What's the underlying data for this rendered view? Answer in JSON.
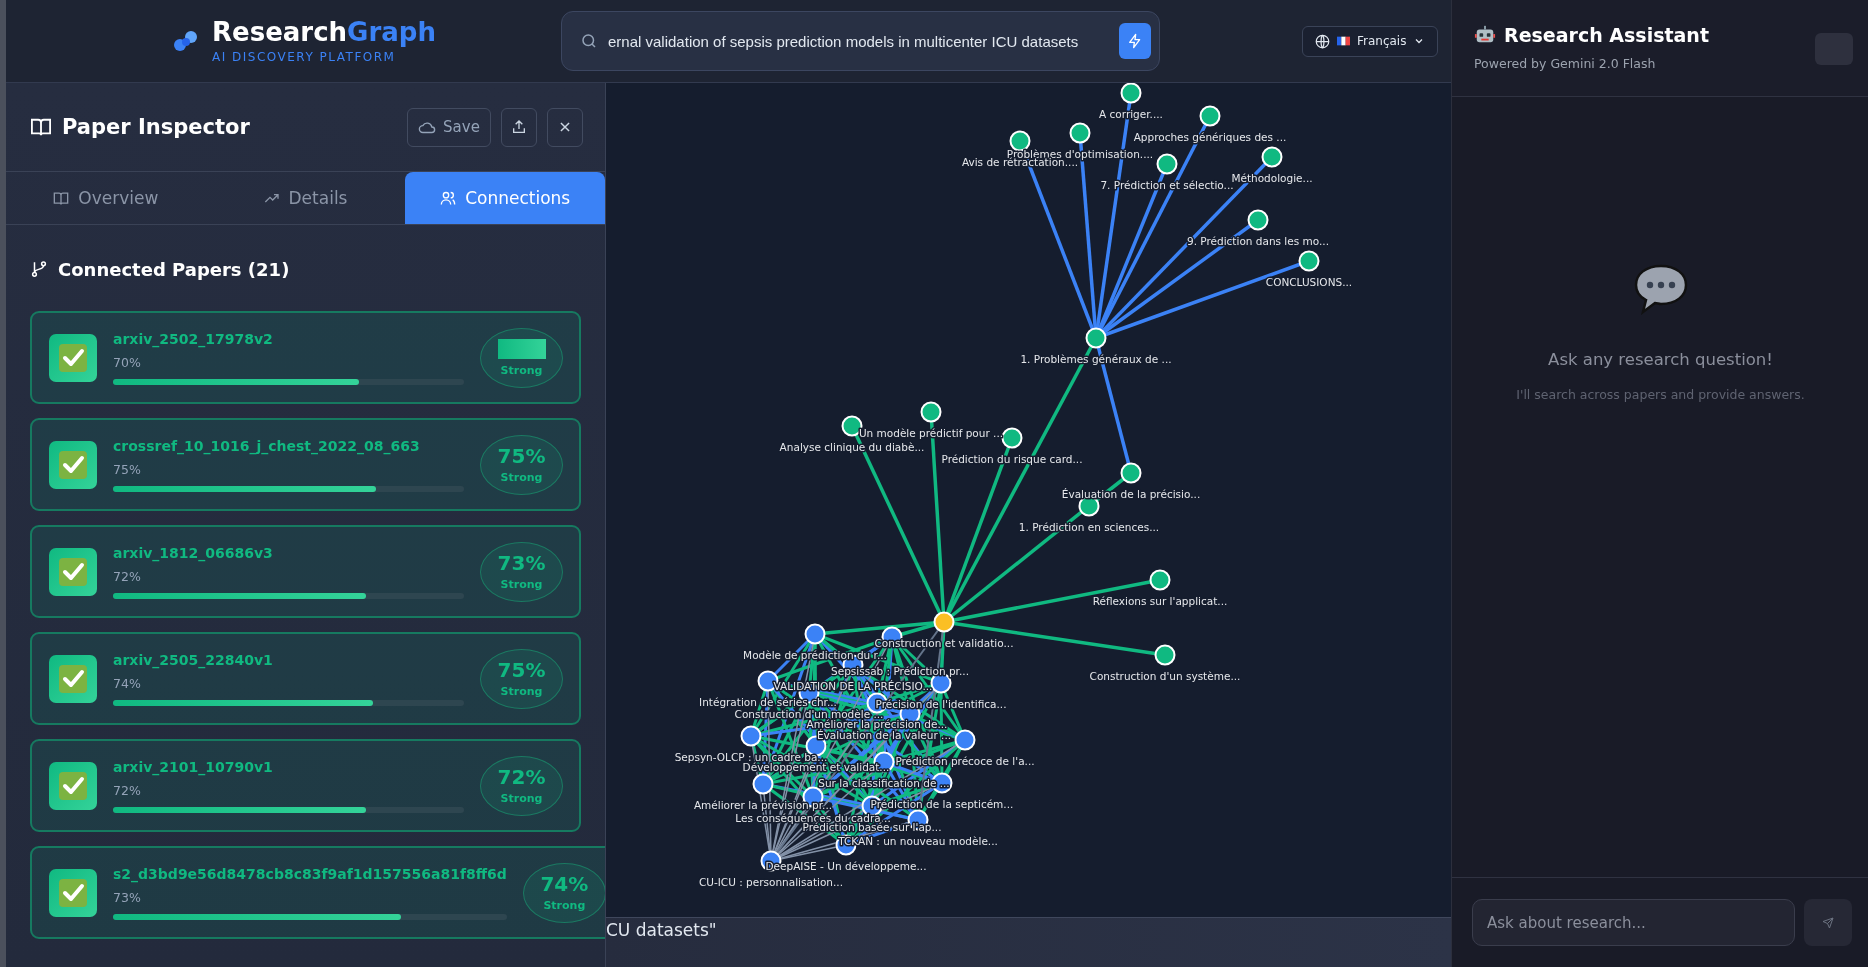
{
  "header": {
    "logo": {
      "text": "Research",
      "accent": "Graph",
      "tagline": "AI DISCOVERY PLATFORM"
    },
    "search": {
      "value": "ernal validation of sepsis prediction models in multicenter ICU datasets"
    },
    "language": {
      "label": "Français"
    }
  },
  "inspector": {
    "title": "Paper Inspector",
    "save": "Save",
    "tabs": [
      {
        "label": "Overview",
        "selected": false
      },
      {
        "label": "Details",
        "selected": false
      },
      {
        "label": "Connections",
        "selected": true
      }
    ],
    "section_title": "Connected Papers (21)",
    "papers": [
      {
        "name": "arxiv_2502_17978v2",
        "similarity": "70%",
        "level": 0.7,
        "badge": "Strong"
      },
      {
        "name": "crossref_10_1016_j_chest_2022_08_663",
        "similarity": "75%",
        "level": 0.75,
        "score": "75%",
        "badge": "Strong"
      },
      {
        "name": "arxiv_1812_06686v3",
        "similarity": "72%",
        "level": 0.72,
        "score": "73%",
        "badge": "Strong"
      },
      {
        "name": "arxiv_2505_22840v1",
        "similarity": "74%",
        "level": 0.74,
        "score": "75%",
        "badge": "Strong"
      },
      {
        "name": "arxiv_2101_10790v1",
        "similarity": "72%",
        "level": 0.72,
        "score": "72%",
        "badge": "Strong"
      },
      {
        "name": "s2_d3bd9e56d8478cb8c83f9af1d157556a81f8ff6d",
        "similarity": "73%",
        "level": 0.73,
        "score": "74%",
        "badge": "Strong"
      }
    ]
  },
  "graph": {
    "nodes": [
      {
        "label": "A corriger....",
        "color": "#10b981"
      },
      {
        "label": "Approches génériques des ...",
        "color": "#10b981"
      },
      {
        "label": "Problèmes d'optimisation....",
        "color": "#10b981"
      },
      {
        "label": "Avis de rétractation....",
        "color": "#10b981"
      },
      {
        "label": "Méthodologie...",
        "color": "#10b981"
      },
      {
        "label": "7. Prédiction et sélectio...",
        "color": "#10b981"
      },
      {
        "label": "9. Prédiction dans les mo...",
        "color": "#10b981"
      },
      {
        "label": "CONCLUSIONS...",
        "color": "#10b981"
      },
      {
        "label": "1. Problèmes généraux de ...",
        "color": "#10b981"
      },
      {
        "label": "Un modèle prédictif pour ...",
        "color": "#10b981"
      },
      {
        "label": "Analyse clinique du diabè...",
        "color": "#10b981"
      },
      {
        "label": "Prédiction du risque card...",
        "color": "#10b981"
      },
      {
        "label": "Évaluation de la précisio...",
        "color": "#10b981"
      },
      {
        "label": "1. Prédiction en sciences...",
        "color": "#10b981"
      },
      {
        "label": "Réflexions sur l'applicat...",
        "color": "#10b981"
      },
      {
        "label": "Construction et validatio...",
        "color": "#fbbf24"
      },
      {
        "label": "Modèle de prédiction du r...",
        "color": "#3b82f6"
      },
      {
        "label": "Sepsissab : Prédiction pr...",
        "color": "#3b82f6"
      },
      {
        "label": "Construction d'un système...",
        "color": "#10b981"
      },
      {
        "label": "VALIDATION DE LA PRÉCISIO...",
        "color": "#3b82f6"
      },
      {
        "label": "Intégration de séries chr...",
        "color": "#3b82f6"
      },
      {
        "label": "Précision de l'identifica...",
        "color": "#3b82f6"
      },
      {
        "label": "Construction d'un modèle ...",
        "color": "#3b82f6"
      },
      {
        "label": "Améliorer la précision de...",
        "color": "#3b82f6"
      },
      {
        "label": "Évaluation de la valeur ...",
        "color": "#3b82f6"
      },
      {
        "label": "Sepsyn-OLCP : un cadre ba...",
        "color": "#3b82f6"
      },
      {
        "label": "Prédiction précoce de l'a...",
        "color": "#3b82f6"
      },
      {
        "label": "Développement et validat...",
        "color": "#3b82f6"
      },
      {
        "label": "Sur la classification de ...",
        "color": "#3b82f6"
      },
      {
        "label": "Améliorer la prévision pr...",
        "color": "#3b82f6"
      },
      {
        "label": "Prédiction de la septicém...",
        "color": "#3b82f6"
      },
      {
        "label": "Les conséquences du cadra...",
        "color": "#3b82f6"
      },
      {
        "label": "Prédiction basée sur l'ap...",
        "color": "#3b82f6"
      },
      {
        "label": "TCKAN : un nouveau modèle...",
        "color": "#3b82f6"
      },
      {
        "label": "DeepAISE - Un développeme...",
        "color": "#3b82f6"
      },
      {
        "label": "CU-ICU : personnalisation...",
        "color": "#3b82f6"
      }
    ]
  },
  "query_echo": "CU datasets\"",
  "assistant": {
    "title": "Research Assistant",
    "subtitle": "Powered by Gemini 2.0 Flash",
    "empty_title": "Ask any research question!",
    "empty_text": "I'll search across papers and provide answers.",
    "input": {
      "placeholder": "Ask about research..."
    }
  }
}
